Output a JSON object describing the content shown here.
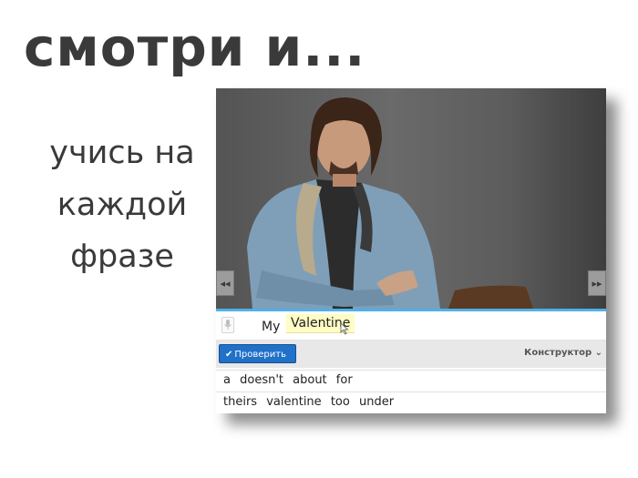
{
  "slide": {
    "title": "смотри и...",
    "subtitle_lines": [
      "учись на",
      "каждой",
      "фразе"
    ]
  },
  "player": {
    "prev_label": "◂◂",
    "next_label": "▸▸",
    "progress_fraction": 1.0,
    "answer_words": [
      "My",
      "Valentine"
    ],
    "check_button_label": "Проверить",
    "constructor_label": "Конструктор",
    "word_rows": [
      [
        "a",
        "doesn't",
        "about",
        "for"
      ],
      [
        "theirs",
        "valentine",
        "too",
        "under"
      ]
    ]
  },
  "colors": {
    "accent_blue": "#2171c9",
    "progress": "#4fb0e8",
    "highlight": "#fffcc4"
  }
}
